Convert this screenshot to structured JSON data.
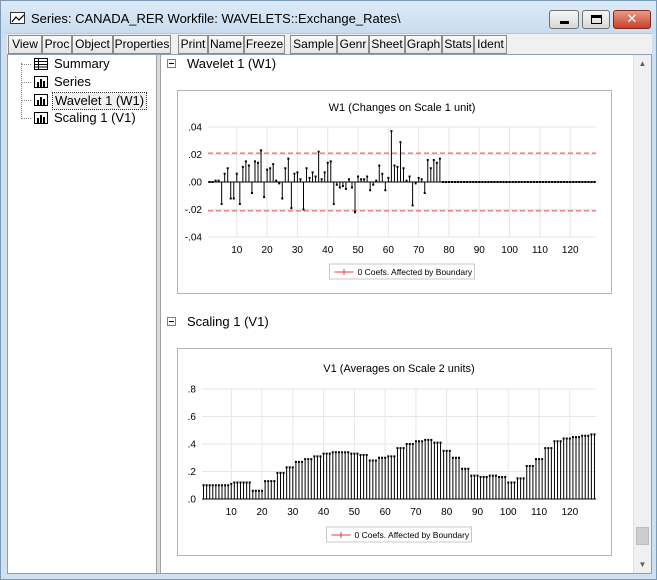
{
  "window": {
    "title": "Series: CANADA_RER   Workfile: WAVELETS::Exchange_Rates\\",
    "icon": "graph-window-icon",
    "controls": {
      "minimize": "minimize-icon",
      "maximize": "maximize-icon",
      "close": "close-icon"
    }
  },
  "toolbar": {
    "buttons": [
      "View",
      "Proc",
      "Object",
      "Properties",
      "Print",
      "Name",
      "Freeze",
      "Sample",
      "Genr",
      "Sheet",
      "Graph",
      "Stats",
      "Ident"
    ]
  },
  "tree": {
    "items": [
      {
        "label": "Summary",
        "icon": "table-icon"
      },
      {
        "label": "Series",
        "icon": "bar-chart-icon"
      },
      {
        "label": "Wavelet 1 (W1)",
        "icon": "bar-chart-icon",
        "selected": true
      },
      {
        "label": "Scaling 1 (V1)",
        "icon": "bar-chart-icon"
      }
    ]
  },
  "sections": {
    "wavelet": {
      "label": "Wavelet 1 (W1)"
    },
    "scaling": {
      "label": "Scaling 1 (V1)"
    }
  },
  "chart_data": [
    {
      "type": "stem",
      "title": "W1 (Changes on Scale 1 unit)",
      "xlabel": "",
      "ylabel": "",
      "x": [
        1,
        2,
        3,
        4,
        5,
        6,
        7,
        8,
        9,
        10,
        11,
        12,
        13,
        14,
        15,
        16,
        17,
        18,
        19,
        20,
        21,
        22,
        23,
        24,
        25,
        26,
        27,
        28,
        29,
        30,
        31,
        32,
        33,
        34,
        35,
        36,
        37,
        38,
        39,
        40,
        41,
        42,
        43,
        44,
        45,
        46,
        47,
        48,
        49,
        50,
        51,
        52,
        53,
        54,
        55,
        56,
        57,
        58,
        59,
        60,
        61,
        62,
        63,
        64,
        65,
        66,
        67,
        68,
        69,
        70,
        71,
        72,
        73,
        74,
        75,
        76,
        77,
        78,
        79,
        80,
        81,
        82,
        83,
        84,
        85,
        86,
        87,
        88,
        89,
        90,
        91,
        92,
        93,
        94,
        95,
        96,
        97,
        98,
        99,
        100,
        101,
        102,
        103,
        104,
        105,
        106,
        107,
        108,
        109,
        110,
        111,
        112,
        113,
        114,
        115,
        116,
        117,
        118,
        119,
        120,
        121,
        122,
        123,
        124,
        125,
        126,
        127,
        128
      ],
      "values": [
        0,
        0,
        0.001,
        0.001,
        -0.016,
        0.006,
        0.01,
        -0.012,
        -0.012,
        0.006,
        -0.016,
        0.011,
        0.015,
        0.012,
        -0.008,
        0.015,
        0.014,
        0.023,
        -0.011,
        0.009,
        0.01,
        0.013,
        0.001,
        -0.001,
        -0.012,
        0.01,
        0.017,
        -0.019,
        0.006,
        0.007,
        0.002,
        -0.02,
        0.01,
        0.003,
        0.007,
        0.004,
        0.022,
        0.002,
        0.007,
        0.014,
        0.015,
        -0.016,
        -0.002,
        -0.004,
        -0.003,
        -0.005,
        0.002,
        -0.004,
        -0.022,
        0.004,
        0.002,
        0.002,
        0.004,
        -0.006,
        -0.002,
        0.001,
        0.012,
        0.006,
        -0.006,
        0.003,
        0.037,
        0.012,
        0.011,
        0.029,
        0.01,
        0.001,
        0.004,
        -0.017,
        -0.001,
        0.003,
        0.002,
        -0.008,
        0.016,
        0.01,
        0.016,
        0.014,
        0.017,
        0,
        0,
        0,
        0,
        0,
        0,
        0,
        0,
        0,
        0,
        0,
        0,
        0,
        0,
        0,
        0,
        0,
        0,
        0,
        0,
        0,
        0,
        0,
        0,
        0,
        0,
        0,
        0,
        0,
        0,
        0,
        0,
        0,
        0,
        0,
        0,
        0,
        0,
        0,
        0,
        0,
        0,
        0,
        0,
        0,
        0,
        0,
        0,
        0,
        0,
        0,
        0
      ],
      "boundary_lines": [
        0.021,
        -0.021
      ],
      "xticks": [
        10,
        20,
        30,
        40,
        50,
        60,
        70,
        80,
        90,
        100,
        110,
        120
      ],
      "yticks": [
        ".04",
        ".02",
        ".00",
        "-.02",
        "-.04"
      ],
      "ylim": [
        -0.04,
        0.04
      ],
      "grid": true,
      "legend": {
        "entries": [
          "0 Coefs. Affected by Boundary"
        ],
        "placement": "bottom-center"
      },
      "colors": {
        "stem": "#000000",
        "boundary": "#e04040"
      }
    },
    {
      "type": "stem",
      "title": "V1 (Averages on Scale 2 units)",
      "xlabel": "",
      "ylabel": "",
      "x": [
        1,
        2,
        3,
        4,
        5,
        6,
        7,
        8,
        9,
        10,
        11,
        12,
        13,
        14,
        15,
        16,
        17,
        18,
        19,
        20,
        21,
        22,
        23,
        24,
        25,
        26,
        27,
        28,
        29,
        30,
        31,
        32,
        33,
        34,
        35,
        36,
        37,
        38,
        39,
        40,
        41,
        42,
        43,
        44,
        45,
        46,
        47,
        48,
        49,
        50,
        51,
        52,
        53,
        54,
        55,
        56,
        57,
        58,
        59,
        60,
        61,
        62,
        63,
        64,
        65,
        66,
        67,
        68,
        69,
        70,
        71,
        72,
        73,
        74,
        75,
        76,
        77,
        78,
        79,
        80,
        81,
        82,
        83,
        84,
        85,
        86,
        87,
        88,
        89,
        90,
        91,
        92,
        93,
        94,
        95,
        96,
        97,
        98,
        99,
        100,
        101,
        102,
        103,
        104,
        105,
        106,
        107,
        108,
        109,
        110,
        111,
        112,
        113,
        114,
        115,
        116,
        117,
        118,
        119,
        120,
        121,
        122,
        123,
        124,
        125,
        126,
        127,
        128
      ],
      "values": [
        0.1,
        0.1,
        0.1,
        0.1,
        0.1,
        0.1,
        0.1,
        0.1,
        0.1,
        0.11,
        0.12,
        0.12,
        0.12,
        0.12,
        0.12,
        0.12,
        0.06,
        0.06,
        0.06,
        0.06,
        0.13,
        0.13,
        0.13,
        0.13,
        0.19,
        0.19,
        0.19,
        0.23,
        0.23,
        0.23,
        0.27,
        0.27,
        0.27,
        0.29,
        0.29,
        0.29,
        0.31,
        0.31,
        0.31,
        0.33,
        0.33,
        0.33,
        0.34,
        0.34,
        0.34,
        0.34,
        0.34,
        0.34,
        0.33,
        0.33,
        0.33,
        0.32,
        0.32,
        0.32,
        0.28,
        0.28,
        0.28,
        0.3,
        0.3,
        0.3,
        0.31,
        0.31,
        0.31,
        0.37,
        0.37,
        0.37,
        0.4,
        0.4,
        0.4,
        0.42,
        0.42,
        0.42,
        0.43,
        0.43,
        0.43,
        0.41,
        0.41,
        0.41,
        0.35,
        0.35,
        0.35,
        0.3,
        0.3,
        0.3,
        0.22,
        0.22,
        0.22,
        0.17,
        0.17,
        0.17,
        0.16,
        0.16,
        0.16,
        0.17,
        0.17,
        0.17,
        0.16,
        0.16,
        0.16,
        0.12,
        0.12,
        0.12,
        0.15,
        0.15,
        0.15,
        0.24,
        0.24,
        0.24,
        0.29,
        0.29,
        0.29,
        0.37,
        0.37,
        0.37,
        0.42,
        0.42,
        0.42,
        0.44,
        0.44,
        0.44,
        0.45,
        0.45,
        0.45,
        0.46,
        0.46,
        0.46,
        0.47,
        0.47,
        0.47
      ],
      "xticks": [
        10,
        20,
        30,
        40,
        50,
        60,
        70,
        80,
        90,
        100,
        110,
        120
      ],
      "yticks": [
        ".8",
        ".6",
        ".4",
        ".2",
        ".0"
      ],
      "ylim": [
        0,
        0.8
      ],
      "grid": true,
      "legend": {
        "entries": [
          "0 Coefs. Affected by Boundary"
        ],
        "placement": "bottom-center"
      },
      "colors": {
        "stem": "#000000",
        "legend_line": "#e04040"
      }
    }
  ]
}
